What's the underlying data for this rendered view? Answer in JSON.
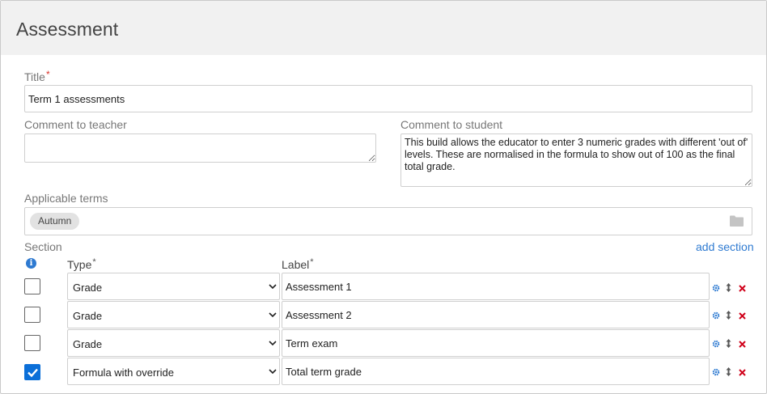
{
  "header": {
    "title": "Assessment"
  },
  "form": {
    "title_label": "Title",
    "title_required": "*",
    "title_value": "Term 1 assessments",
    "comment_teacher_label": "Comment to teacher",
    "comment_teacher_value": "",
    "comment_student_label": "Comment to student",
    "comment_student_value": "This build allows the educator to enter 3 numeric grades with different 'out of' levels. These are normalised in the formula to show out of 100 as the final total grade.",
    "terms_label": "Applicable terms",
    "terms": [
      "Autumn"
    ]
  },
  "section": {
    "label": "Section",
    "add_label": "add section",
    "type_header": "Type",
    "label_header": "Label",
    "required_mark": "*",
    "rows": [
      {
        "checked": false,
        "type": "Grade",
        "label": "Assessment 1"
      },
      {
        "checked": false,
        "type": "Grade",
        "label": "Assessment 2"
      },
      {
        "checked": false,
        "type": "Grade",
        "label": "Term exam"
      },
      {
        "checked": true,
        "type": "Formula with override",
        "label": "Total term grade"
      }
    ]
  },
  "icons": {
    "info": "info-icon",
    "folder": "folder-icon",
    "settings": "gear-icon",
    "reorder": "drag-handle-icon",
    "delete": "close-icon",
    "checkmark": "checkmark-icon",
    "dropdown": "chevron-down-icon"
  },
  "colors": {
    "accent": "#2e7ad1",
    "checkbox_checked": "#0b6fd8",
    "required": "#d9342b",
    "delete": "#d0021b",
    "header_bg": "#f1f1f1"
  }
}
